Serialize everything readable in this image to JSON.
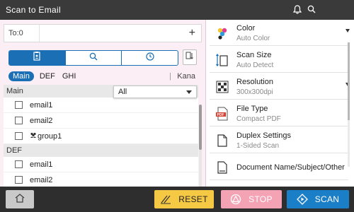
{
  "title": "Scan to Email",
  "header_icons": [
    "bell-icon",
    "search-icon"
  ],
  "to": {
    "label": "To:0",
    "add": "+"
  },
  "tabs": [
    {
      "name": "address-book-tab",
      "icon": "address-book-icon",
      "active": true
    },
    {
      "name": "search-tab",
      "icon": "search-icon",
      "active": false
    },
    {
      "name": "history-tab",
      "icon": "clock-icon",
      "active": false
    }
  ],
  "index": {
    "main": "Main",
    "def": "DEF",
    "ghi": "GHI",
    "separator": "|",
    "kana": "Kana"
  },
  "filter": {
    "value": "All"
  },
  "list": {
    "sections": [
      {
        "header": "Main",
        "items": [
          "email1",
          "email2",
          "group1"
        ]
      },
      {
        "header": "DEF",
        "items": [
          "email1",
          "email2"
        ]
      }
    ]
  },
  "settings": [
    {
      "name": "Color",
      "value": "Auto Color",
      "icon": "color-icon",
      "dropdown": true
    },
    {
      "name": "Scan Size",
      "value": "Auto Detect",
      "icon": "scan-size-icon",
      "dropdown": false
    },
    {
      "name": "Resolution",
      "value": "300x300dpi",
      "icon": "resolution-icon",
      "dropdown": true
    },
    {
      "name": "File Type",
      "value": "Compact PDF",
      "icon": "pdf-icon",
      "dropdown": false
    },
    {
      "name": "Duplex Settings",
      "value": "1-Sided Scan",
      "icon": "duplex-icon",
      "dropdown": false
    },
    {
      "name": "Document Name/Subject/Other",
      "value": "",
      "icon": "document-icon",
      "dropdown": false
    }
  ],
  "bottom": {
    "home": "home-icon",
    "reset": "RESET",
    "stop": "STOP",
    "scan": "SCAN"
  },
  "colors": {
    "accent": "#1a6fb5",
    "reset": "#f6c945",
    "stop": "#f4a3b5",
    "scan": "#1b7fc8",
    "left_bg": "#fbeef5"
  }
}
